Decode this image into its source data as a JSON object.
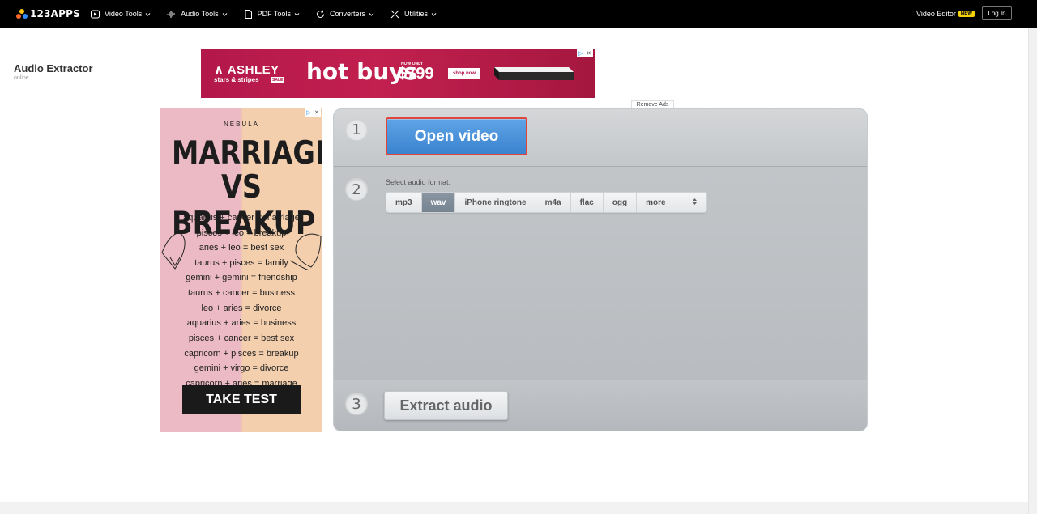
{
  "header": {
    "logo_text": "123APPS",
    "nav": [
      {
        "label": "Video Tools",
        "icon": "play-circle-icon"
      },
      {
        "label": "Audio Tools",
        "icon": "waveform-icon"
      },
      {
        "label": "PDF Tools",
        "icon": "document-icon"
      },
      {
        "label": "Converters",
        "icon": "refresh-icon"
      },
      {
        "label": "Utilities",
        "icon": "tools-icon"
      }
    ],
    "video_editor": "Video Editor",
    "new_badge": "NEW",
    "login": "Log In"
  },
  "page": {
    "title": "Audio Extractor",
    "subtitle": "online"
  },
  "ad_top": {
    "brand": "ASHLEY",
    "tagline": "stars & stripes",
    "sale": "SALE",
    "headline": "hot buys",
    "now_only": "NOW ONLY",
    "price": "$799",
    "cta": "shop now"
  },
  "remove_ads": "Remove Ads",
  "ad_side": {
    "brand": "NEBULA",
    "headline_1": "MARRIAGE",
    "headline_2": "VS BREAKUP",
    "lines": [
      "aquarius + cancer = marriage",
      "pisces + leo = breakup",
      "aries + leo = best sex",
      "taurus + pisces = family",
      "gemini + gemini = friendship",
      "taurus + cancer = business",
      "leo + aries = divorce",
      "aquarius + aries = business",
      "pisces + cancer = best sex",
      "capricorn + pisces = breakup",
      "gemini + virgo = divorce",
      "capricorn + aries = marriage"
    ],
    "cta": "TAKE TEST"
  },
  "tool": {
    "step1": {
      "number": "1",
      "button": "Open video"
    },
    "step2": {
      "number": "2",
      "label": "Select audio format:",
      "formats": [
        "mp3",
        "wav",
        "iPhone ringtone",
        "m4a",
        "flac",
        "ogg"
      ],
      "selected": "wav",
      "more": "more"
    },
    "step3": {
      "number": "3",
      "button": "Extract audio"
    }
  },
  "colors": {
    "open_button": "#3a83cf",
    "open_button_border": "#e0453a",
    "ad_top_bg": "#b3184b"
  }
}
